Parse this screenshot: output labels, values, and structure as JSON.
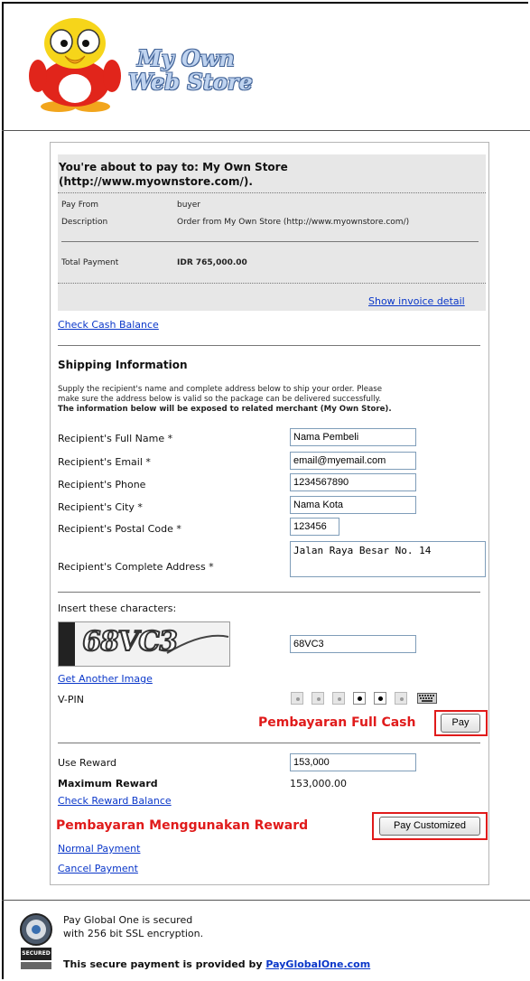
{
  "header": {
    "logo_line1": "My Own",
    "logo_line2": "Web Store"
  },
  "merchant": {
    "title_line1": "You're about to pay to: My Own Store",
    "title_line2": "(http://www.myownstore.com/).",
    "pay_from_label": "Pay From",
    "pay_from_value": "buyer",
    "description_label": "Description",
    "description_value": "Order from My Own Store (http://www.myownstore.com/)",
    "total_label": "Total Payment",
    "total_value": "IDR 765,000.00",
    "invoice_link": "Show invoice detail"
  },
  "check_cash_balance": "Check Cash Balance",
  "shipping": {
    "heading": "Shipping Information",
    "note_line1": "Supply the recipient's name and complete address below to ship your order. Please",
    "note_line2": "make sure the address below is valid so the package can be delivered successfully.",
    "note_bold": "The information below will be exposed to related merchant (My Own Store).",
    "fields": {
      "name_label": "Recipient's Full Name *",
      "name_value": "Nama Pembeli",
      "email_label": "Recipient's Email *",
      "email_value": "email@myemail.com",
      "phone_label": "Recipient's Phone",
      "phone_value": "1234567890",
      "city_label": "Recipient's City *",
      "city_value": "Nama Kota",
      "postal_label": "Recipient's Postal Code *",
      "postal_value": "123456",
      "address_label": "Recipient's Complete Address *",
      "address_value": "Jalan Raya Besar No. 14"
    }
  },
  "captcha": {
    "prompt": "Insert these characters:",
    "image_text": "68VC3",
    "input_value": "68VC3",
    "another_image": "Get Another Image"
  },
  "vpin": {
    "label": "V-PIN",
    "keys_filled": [
      false,
      false,
      false,
      true,
      true,
      false
    ],
    "keyboard_icon": "keyboard-icon"
  },
  "full_cash": {
    "annotation": "Pembayaran Full Cash",
    "pay_button": "Pay"
  },
  "reward": {
    "use_label": "Use Reward",
    "use_value": "153,000",
    "max_label": "Maximum Reward",
    "max_value": "153,000.00",
    "check_link": "Check Reward Balance",
    "annotation": "Pembayaran Menggunakan Reward",
    "pay_button": "Pay Customized"
  },
  "links": {
    "normal": "Normal Payment",
    "cancel": "Cancel Payment"
  },
  "footer": {
    "ssl_line1": "Pay Global One is secured",
    "ssl_line2": "with 256 bit SSL encryption.",
    "seal_text": "SECURED",
    "provided_text": "This secure payment is provided by ",
    "provider_link": "PayGlobalOne.com"
  },
  "colors": {
    "link": "#0a37c9",
    "annotation_red": "#e01b1b",
    "panel_gray": "#e7e7e7"
  }
}
